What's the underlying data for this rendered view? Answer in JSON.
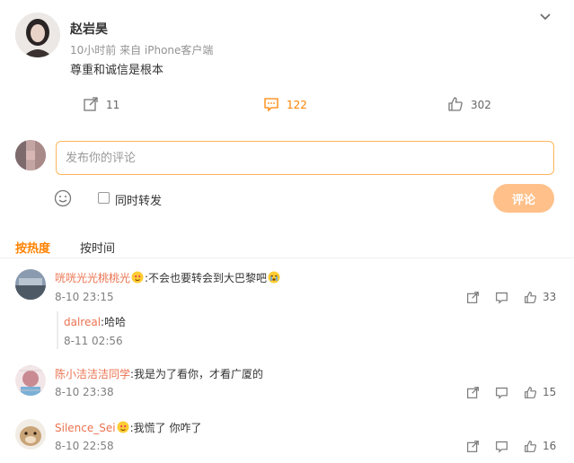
{
  "post": {
    "author": "赵岩昊",
    "meta": "10小时前 来自 iPhone客户端",
    "text": "尊重和诚信是根本",
    "actions": {
      "forward_count": "11",
      "comment_count": "122",
      "like_count": "302"
    }
  },
  "composer": {
    "placeholder": "发布你的评论",
    "forward_label": "同时转发",
    "submit_label": "评论"
  },
  "sort": {
    "hot": "按热度",
    "time": "按时间"
  },
  "comments": [
    {
      "user": "咣咣光光桃桃光",
      "text": ":不会也要转会到大巴黎吧",
      "time": "8-10 23:15",
      "likes": "33",
      "reply": {
        "user": "dalreal",
        "text": ":哈哈",
        "time": "8-11 02:56"
      }
    },
    {
      "user": "陈小洁洁洁同学",
      "text": ":我是为了看你，才看广厦的",
      "time": "8-10 23:38",
      "likes": "15"
    },
    {
      "user": "Silence_Sei",
      "text": ":我慌了 你咋了",
      "time": "8-10 22:58",
      "likes": "16"
    }
  ],
  "icons": {
    "collapse": "chevron-down-icon",
    "forward": "share-icon",
    "comment": "comment-icon",
    "like": "thumbs-up-icon",
    "emoji": "smiley-icon"
  },
  "colors": {
    "accent": "#ff8200",
    "username": "#eb7350",
    "submit_disabled": "#ffc08a"
  }
}
